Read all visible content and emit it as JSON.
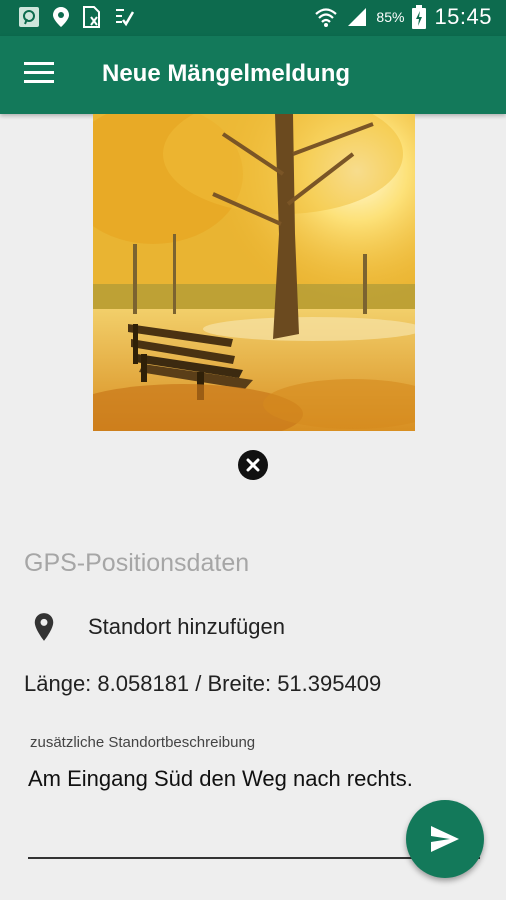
{
  "statusbar": {
    "battery": "85%",
    "time": "15:45"
  },
  "appbar": {
    "title": "Neue Mängelmeldung"
  },
  "photo": {
    "description_icon": "autumn-park-bench-photo"
  },
  "gps": {
    "section_title": "GPS-Positionsdaten",
    "add_location_label": "Standort hinzufügen",
    "coordinates": "Länge: 8.058181 / Breite: 51.395409"
  },
  "location_description": {
    "label": "zusätzliche Standortbeschreibung",
    "value": "Am Eingang Süd den Weg nach rechts."
  },
  "colors": {
    "primary": "#13795a",
    "statusbar": "#0d6b4e",
    "background": "#eeeeee"
  }
}
